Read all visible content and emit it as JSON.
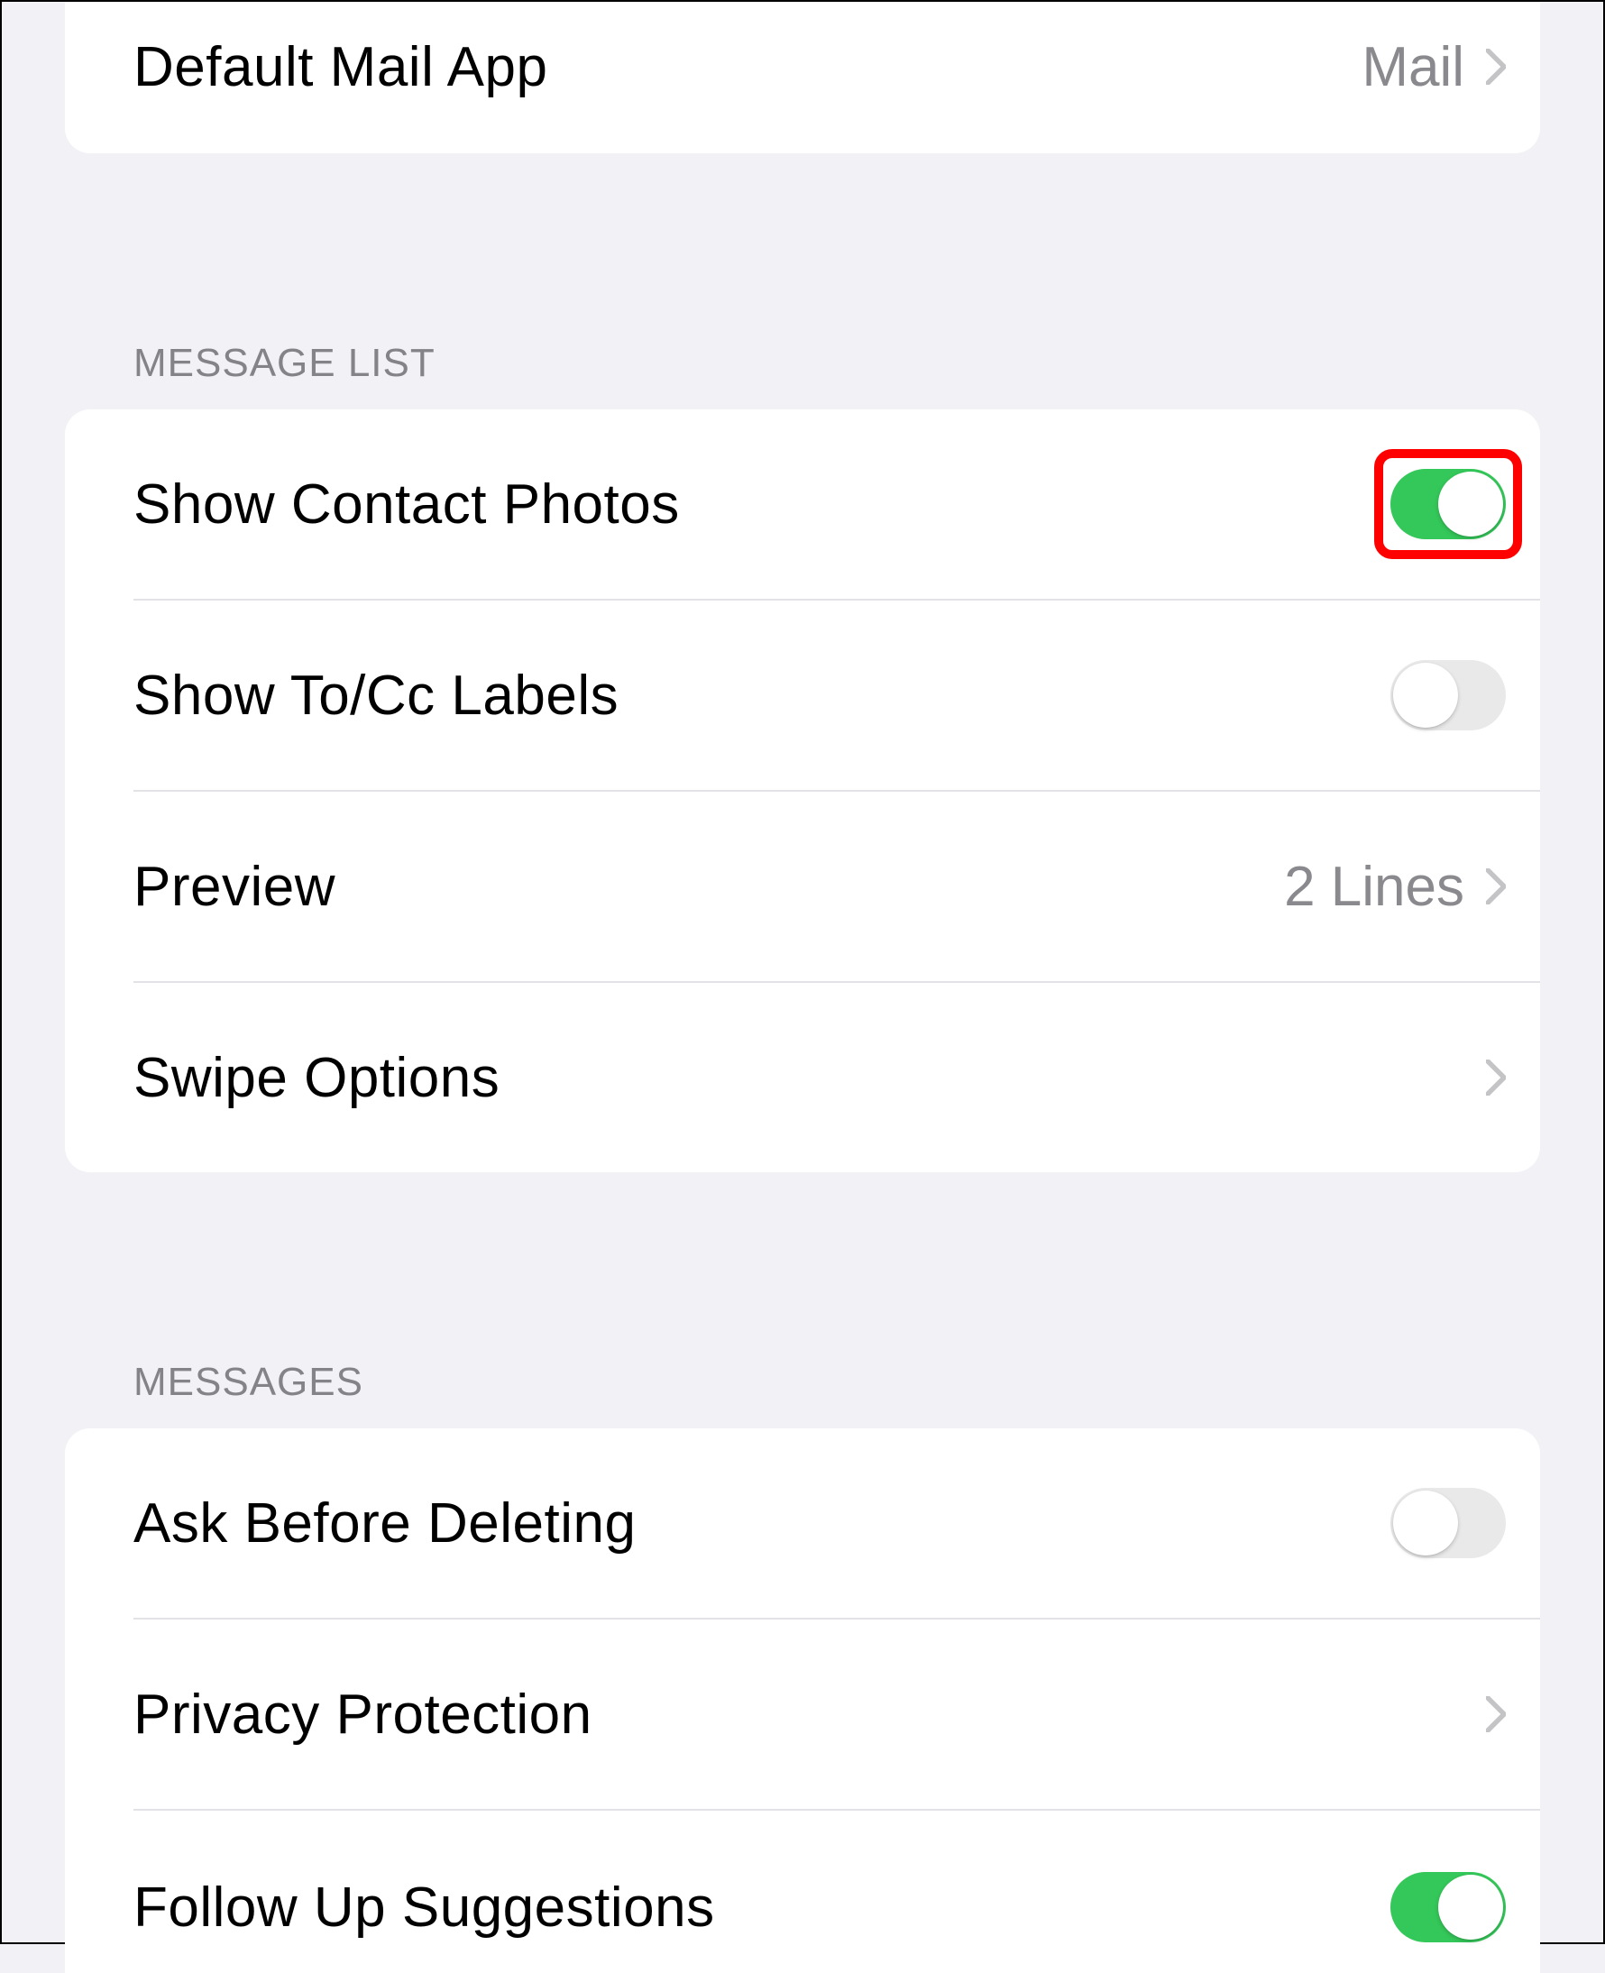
{
  "top": {
    "default_mail_app": {
      "label": "Default Mail App",
      "value": "Mail"
    }
  },
  "message_list": {
    "header": "MESSAGE LIST",
    "show_contact_photos": {
      "label": "Show Contact Photos",
      "on": true,
      "highlighted": true
    },
    "show_tocc_labels": {
      "label": "Show To/Cc Labels",
      "on": false
    },
    "preview": {
      "label": "Preview",
      "value": "2 Lines"
    },
    "swipe_options": {
      "label": "Swipe Options"
    }
  },
  "messages": {
    "header": "MESSAGES",
    "ask_before_deleting": {
      "label": "Ask Before Deleting",
      "on": false
    },
    "privacy_protection": {
      "label": "Privacy Protection"
    },
    "follow_up_suggestions": {
      "label": "Follow Up Suggestions",
      "on": true
    }
  }
}
